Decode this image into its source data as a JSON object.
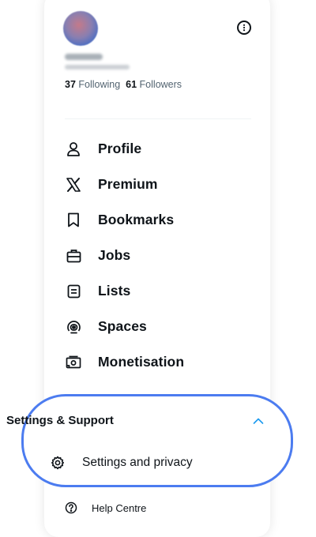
{
  "profile": {
    "following_count": "37",
    "following_label": "Following",
    "followers_count": "61",
    "followers_label": "Followers"
  },
  "nav": {
    "items": [
      {
        "label": "Profile",
        "icon": "person-icon"
      },
      {
        "label": "Premium",
        "icon": "x-logo-icon"
      },
      {
        "label": "Bookmarks",
        "icon": "bookmark-icon"
      },
      {
        "label": "Jobs",
        "icon": "briefcase-icon"
      },
      {
        "label": "Lists",
        "icon": "list-icon"
      },
      {
        "label": "Spaces",
        "icon": "spaces-icon"
      },
      {
        "label": "Monetisation",
        "icon": "money-icon"
      }
    ]
  },
  "settings_support": {
    "heading": "Settings & Support",
    "expanded": true,
    "chevron_color": "#1d9bf0",
    "settings_label": "Settings and privacy",
    "help_label": "Help Centre"
  },
  "colors": {
    "highlight": "#4c7cf0",
    "text_primary": "#0f1419",
    "text_secondary": "#536471"
  }
}
